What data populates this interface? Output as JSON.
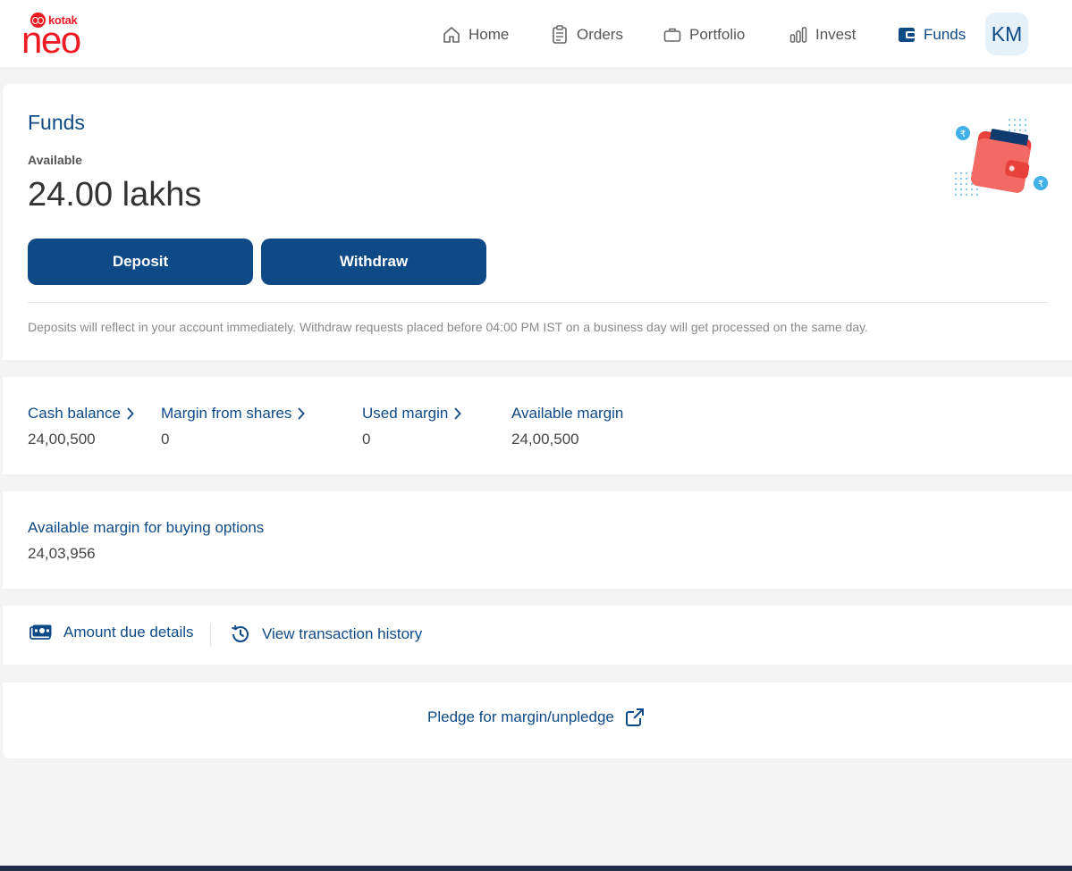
{
  "brand": {
    "top_word": "kotak",
    "main_word": "neo"
  },
  "nav": {
    "items": [
      {
        "label": "Home",
        "icon": "home-icon"
      },
      {
        "label": "Orders",
        "icon": "clipboard-icon"
      },
      {
        "label": "Portfolio",
        "icon": "briefcase-icon"
      },
      {
        "label": "Invest",
        "icon": "bar-chart-icon"
      },
      {
        "label": "Funds",
        "icon": "wallet-icon",
        "active": true
      }
    ],
    "avatar_initials": "KM"
  },
  "funds": {
    "title": "Funds",
    "available_label": "Available",
    "available_amount": "24.00 lakhs",
    "deposit_label": "Deposit",
    "withdraw_label": "Withdraw",
    "note": "Deposits will reflect in your account immediately. Withdraw requests placed before 04:00 PM IST on a business day will get processed on the same day."
  },
  "balances": [
    {
      "label": "Cash balance",
      "value": "24,00,500",
      "has_chevron": true
    },
    {
      "label": "Margin from shares",
      "value": "0",
      "has_chevron": true
    },
    {
      "label": "Used margin",
      "value": "0",
      "has_chevron": true
    },
    {
      "label": "Available margin",
      "value": "24,00,500",
      "has_chevron": false
    }
  ],
  "options_margin": {
    "label": "Available margin for buying options",
    "value": "24,03,956"
  },
  "links": {
    "amount_due": "Amount due details",
    "transaction_history": "View transaction history",
    "pledge": "Pledge for margin/unpledge"
  },
  "colors": {
    "primary": "#0e4a86",
    "brand_red": "#ed1c24",
    "background": "#f3f3f3"
  }
}
